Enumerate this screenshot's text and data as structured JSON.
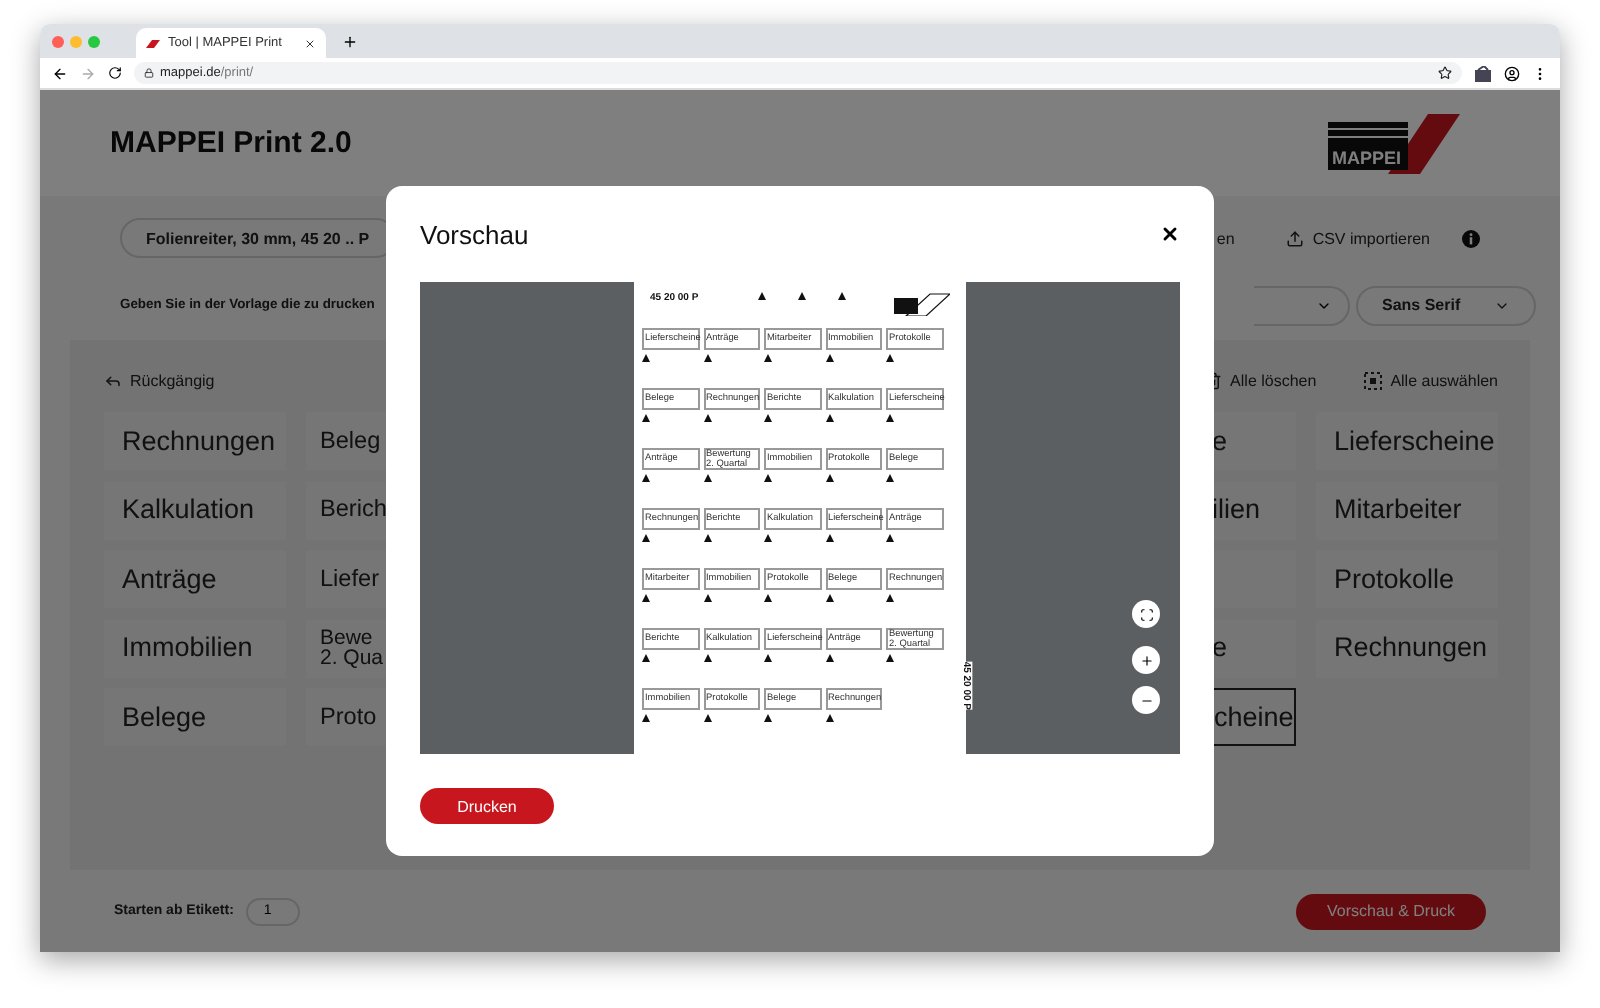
{
  "browser": {
    "tab_title": "Tool | MAPPEI Print",
    "url_host": "mappei.de",
    "url_path": "/print/"
  },
  "app": {
    "title": "MAPPEI Print 2.0",
    "logo_text": "MAPPEI",
    "template_select": "Folienreiter, 30 mm, 45 20 .. P",
    "action_fragment": "en",
    "csv_import": "CSV importieren",
    "instruction": "Geben Sie in der Vorlage die zu drucken",
    "font_select": "Sans Serif",
    "undo": "Rückgängig",
    "clear_all": "Alle löschen",
    "select_all": "Alle auswählen",
    "tile_columns": [
      {
        "tiles": [
          {
            "text": "Rechnungen",
            "selected": false
          },
          {
            "text": "Kalkulation",
            "selected": false
          },
          {
            "text": "Anträge",
            "selected": false
          },
          {
            "text": "Immobilien",
            "selected": false
          },
          {
            "text": "Belege",
            "selected": false
          }
        ]
      },
      {
        "tiles": [
          {
            "text": "Beleg",
            "selected": false
          },
          {
            "text": "Berich",
            "selected": false
          },
          {
            "text": "Liefer",
            "selected": false
          },
          {
            "text": "Bewe\n2. Qua",
            "selected": false
          },
          {
            "text": "Proto",
            "selected": false
          }
        ]
      },
      {
        "tiles": [
          {
            "text": "e",
            "selected": false
          },
          {
            "text": "ilien",
            "selected": false
          },
          {
            "selected": false
          },
          {
            "text": "e",
            "selected": false
          },
          {
            "text": "cheine",
            "selected": true
          }
        ]
      },
      {
        "tiles": [
          {
            "text": "Lieferscheine",
            "selected": false
          },
          {
            "text": "Mitarbeiter",
            "selected": false
          },
          {
            "text": "Protokolle",
            "selected": false
          },
          {
            "text": "Rechnungen",
            "selected": false
          }
        ]
      }
    ],
    "start_label": "Starten ab Etikett:",
    "start_value": "1",
    "preview_button": "Vorschau & Druck"
  },
  "modal": {
    "title": "Vorschau",
    "print_button": "Drucken",
    "sheet": {
      "code": "45 20 00 P",
      "side_code": "45 20 00 P",
      "rows": [
        [
          "Lieferscheine",
          "Anträge",
          "Mitarbeiter",
          "Immobilien",
          "Protokolle"
        ],
        [
          "Belege",
          "Rechnungen",
          "Berichte",
          "Kalkulation",
          "Lieferscheine"
        ],
        [
          "Anträge",
          "Bewertung\n2. Quartal",
          "Immobilien",
          "Protokolle",
          "Belege"
        ],
        [
          "Rechnungen",
          "Berichte",
          "Kalkulation",
          "Lieferscheine",
          "Anträge"
        ],
        [
          "Mitarbeiter",
          "Immobilien",
          "Protokolle",
          "Belege",
          "Rechnungen"
        ],
        [
          "Berichte",
          "Kalkulation",
          "Lieferscheine",
          "Anträge",
          "Bewertung\n2. Quartal"
        ],
        [
          "Immobilien",
          "Protokolle",
          "Belege",
          "Rechnungen"
        ]
      ]
    }
  }
}
